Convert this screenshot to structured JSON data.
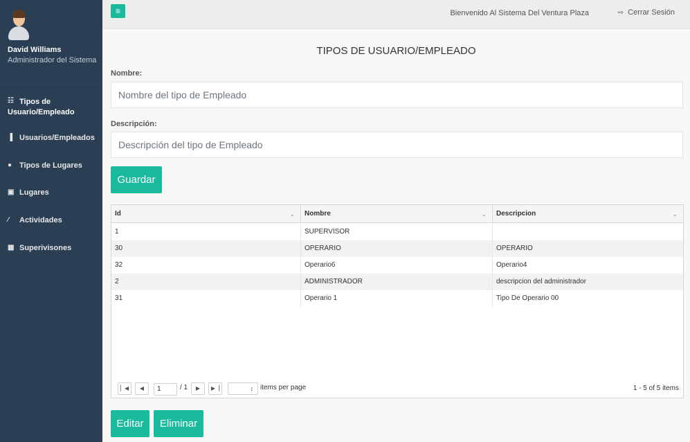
{
  "sidebar": {
    "user_name": "David Williams",
    "user_role": "Administrador del Sistema",
    "items": [
      {
        "label_line1": "Tipos de",
        "label_line2": "Usuario/Empleado",
        "icon": "sitemap-icon"
      },
      {
        "label": "Usuarios/Empleados",
        "icon": "bar-chart-icon"
      },
      {
        "label": "Tipos de Lugares",
        "icon": "globe-icon"
      },
      {
        "label": "Lugares",
        "icon": "picture-icon"
      },
      {
        "label": "Actividades",
        "icon": "magic-wand-icon"
      },
      {
        "label": "Superivisones",
        "icon": "table-icon"
      }
    ]
  },
  "header": {
    "toggle_icon": "≡",
    "welcome": "Bienvenido Al Sistema Del Ventura Plaza",
    "logout": "Cerrar Sesión"
  },
  "main": {
    "title": "TIPOS DE USUARIO/EMPLEADO",
    "name_label": "Nombre:",
    "name_placeholder": "Nombre del tipo de Empleado",
    "desc_label": "Descripción:",
    "desc_placeholder": "Descripción del tipo de Empleado",
    "save_button": "Guardar",
    "edit_button": "Editar",
    "delete_button": "Eliminar"
  },
  "grid": {
    "columns": [
      "Id",
      "Nombre",
      "Descripcion"
    ],
    "rows": [
      {
        "id": "1",
        "nombre": "SUPERVISOR",
        "descripcion": ""
      },
      {
        "id": "30",
        "nombre": "OPERARIO",
        "descripcion": "OPERARIO"
      },
      {
        "id": "32",
        "nombre": "Operario6",
        "descripcion": "Operario4"
      },
      {
        "id": "2",
        "nombre": "ADMINISTRADOR",
        "descripcion": "descripcion del administrador"
      },
      {
        "id": "31",
        "nombre": "Operario 1",
        "descripcion": "Tipo De Operario 00"
      }
    ],
    "pager": {
      "page": "1",
      "of": "/ 1",
      "items_per_page": "items per page",
      "info": "1 - 5 of 5 items"
    }
  },
  "colors": {
    "sidebar_bg": "#2a3f54",
    "accent": "#1abb9c"
  }
}
